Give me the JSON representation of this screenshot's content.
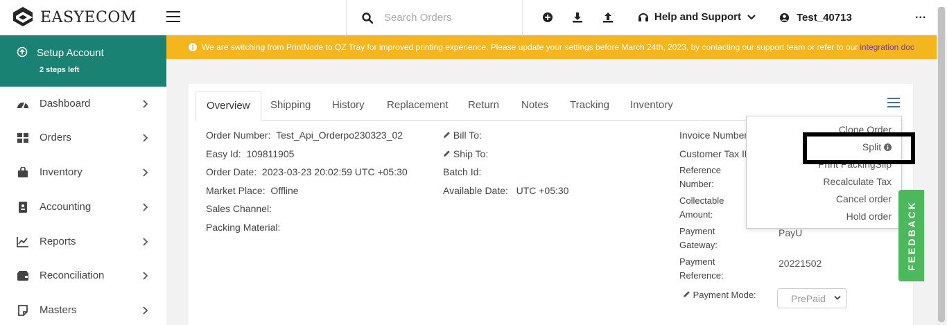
{
  "app": {
    "logo_text": "EASYECOM"
  },
  "header": {
    "search_placeholder": "Search Orders",
    "help_label": "Help and Support",
    "user_label": "Test_40713",
    "more_label": "..."
  },
  "sidebar": {
    "setup_title": "Setup Account",
    "setup_sub": "2 steps left",
    "items": [
      {
        "label": "Dashboard",
        "icon": "dashboard-icon"
      },
      {
        "label": "Orders",
        "icon": "grid-icon"
      },
      {
        "label": "Inventory",
        "icon": "bag-icon"
      },
      {
        "label": "Accounting",
        "icon": "ledger-icon"
      },
      {
        "label": "Reports",
        "icon": "chart-icon"
      },
      {
        "label": "Reconciliation",
        "icon": "wallet-icon"
      },
      {
        "label": "Masters",
        "icon": "note-icon"
      }
    ]
  },
  "banner": {
    "text": "We are switching from PrintNode to QZ Tray for improved printing experience. Please update your settings before March 24th, 2023, by contacting our support team or refer to our",
    "link": "integration doc"
  },
  "tabs": [
    "Overview",
    "Shipping",
    "History",
    "Replacement",
    "Return",
    "Notes",
    "Tracking",
    "Inventory"
  ],
  "order": {
    "order_number_label": "Order Number:",
    "order_number": "Test_Api_Orderpo230323_02",
    "easy_id_label": "Easy Id:",
    "easy_id": "109811905",
    "order_date_label": "Order Date:",
    "order_date": "2023-03-23 20:02:59 UTC +05:30",
    "market_place_label": "Market Place:",
    "market_place": "Offline",
    "sales_channel_label": "Sales Channel:",
    "packing_material_label": "Packing Material:",
    "bill_to_label": "Bill To:",
    "ship_to_label": "Ship To:",
    "batch_id_label": "Batch Id:",
    "available_date_label": "Available Date:",
    "available_date": "UTC +05:30",
    "invoice_number_label": "Invoice Number",
    "customer_tax_label": "Customer Tax ID",
    "reference_label_1": "Reference",
    "reference_label_2": "Number:",
    "collectable_label_1": "Collectable",
    "collectable_label_2": "Amount:",
    "payment_gateway_label_1": "Payment",
    "payment_gateway_label_2": "Gateway:",
    "payment_gateway": "PayU",
    "payment_reference_label_1": "Payment",
    "payment_reference_label_2": "Reference:",
    "payment_reference": "20221502",
    "payment_mode_label": "Payment Mode:",
    "payment_mode_value": "PrePaid"
  },
  "actions_menu": {
    "items": [
      "Clone Order",
      "Split",
      "Print PackingSlip",
      "Recalculate Tax",
      "Cancel order",
      "Hold order"
    ]
  },
  "feedback": {
    "label": "FEEDBACK"
  },
  "colors": {
    "brand_teal": "#198272",
    "banner": "#f5b61d",
    "feedback": "#4cb85c",
    "link": "#6a38c9"
  }
}
